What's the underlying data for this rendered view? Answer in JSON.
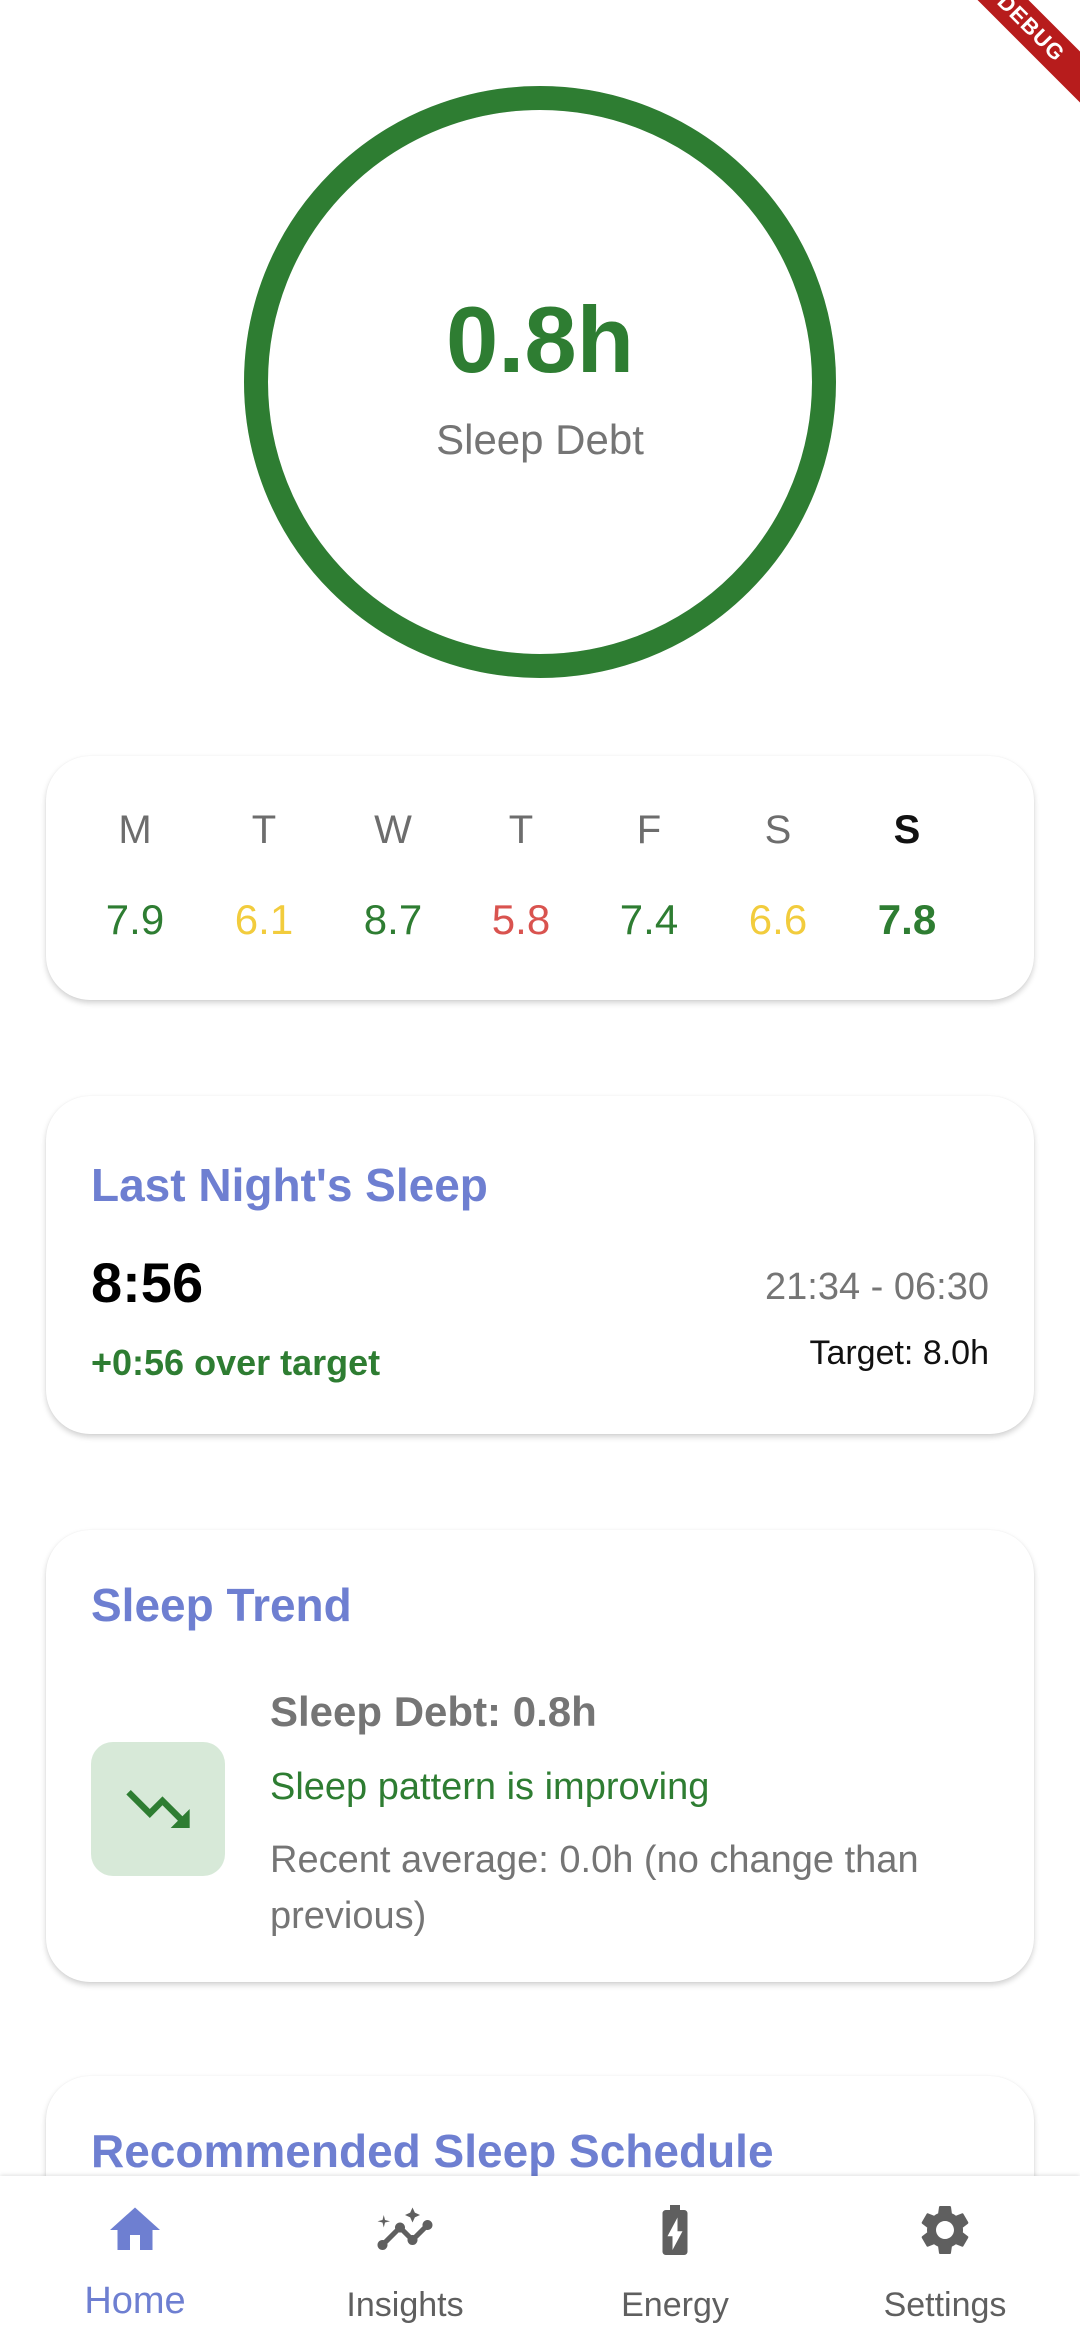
{
  "debug_banner": "DEBUG",
  "summary": {
    "value": "0.8h",
    "label": "Sleep Debt",
    "ring_fraction": 1.0,
    "ring_color": "#2e7d32"
  },
  "week": {
    "days": [
      {
        "day": "M",
        "value": "7.9",
        "color": "#2e7d32",
        "today": false
      },
      {
        "day": "T",
        "value": "6.1",
        "color": "#f2cc3d",
        "today": false
      },
      {
        "day": "W",
        "value": "8.7",
        "color": "#2e7d32",
        "today": false
      },
      {
        "day": "T",
        "value": "5.8",
        "color": "#d9534f",
        "today": false
      },
      {
        "day": "F",
        "value": "7.4",
        "color": "#2e7d32",
        "today": false
      },
      {
        "day": "S",
        "value": "6.6",
        "color": "#f2cc3d",
        "today": false
      },
      {
        "day": "S",
        "value": "7.8",
        "color": "#2e7d32",
        "today": true
      }
    ]
  },
  "last_night": {
    "title": "Last Night's Sleep",
    "duration": "8:56",
    "over_target": "+0:56 over target",
    "range": "21:34 - 06:30",
    "target": "Target: 8.0h"
  },
  "trend": {
    "title": "Sleep Trend",
    "icon": "trending-down-icon",
    "debt": "Sleep Debt: 0.8h",
    "status": "Sleep pattern is improving",
    "average": "Recent average: 0.0h (no change than previous)"
  },
  "schedule": {
    "title": "Recommended Sleep Schedule"
  },
  "nav": {
    "items": [
      {
        "label": "Home",
        "icon": "home-icon",
        "active": true
      },
      {
        "label": "Insights",
        "icon": "insights-icon",
        "active": false
      },
      {
        "label": "Energy",
        "icon": "battery-charging-icon",
        "active": false
      },
      {
        "label": "Settings",
        "icon": "gear-icon",
        "active": false
      }
    ]
  },
  "colors": {
    "accent": "#6e7fd1",
    "good": "#2e7d32",
    "warning": "#f2cc3d",
    "bad": "#d9534f",
    "muted": "#757575"
  }
}
